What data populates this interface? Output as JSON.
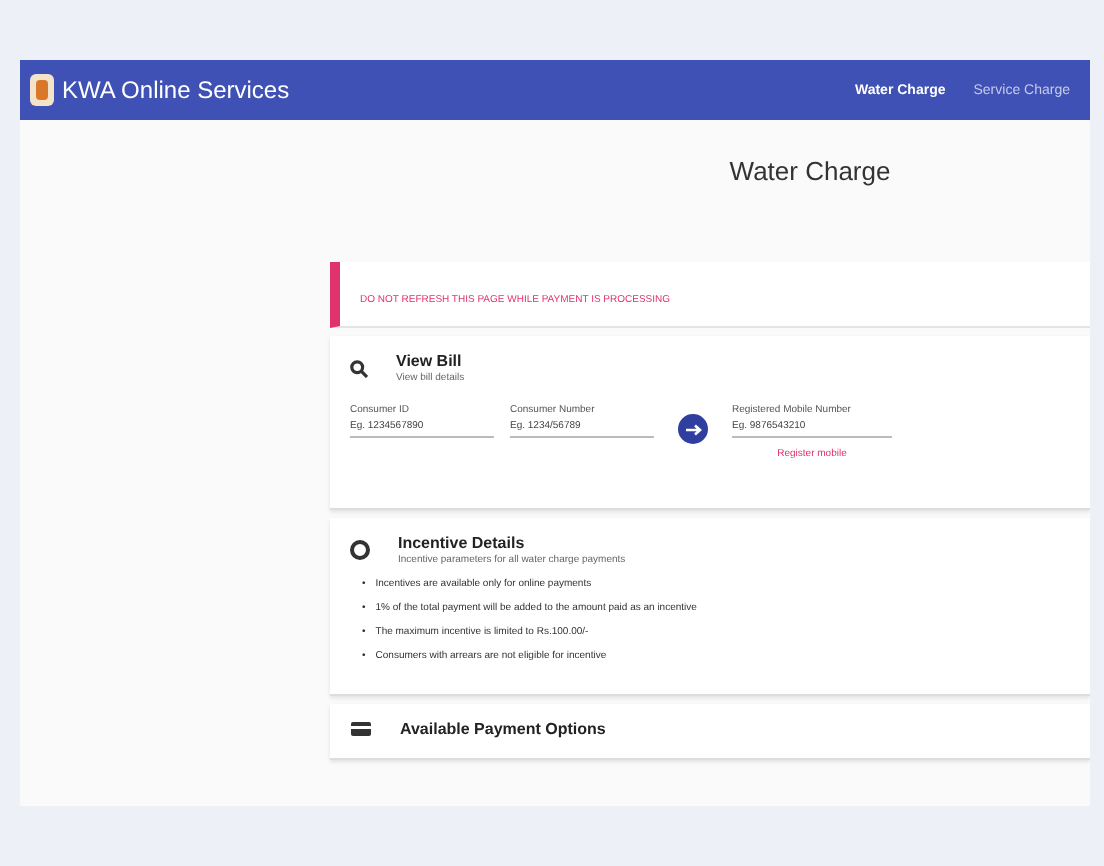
{
  "header": {
    "brand": "KWA Online Services",
    "nav": [
      {
        "label": "Water Charge",
        "selected": true
      },
      {
        "label": "Service Charge",
        "selected": false
      }
    ]
  },
  "page_title": "Water Charge",
  "alert": "DO NOT REFRESH THIS PAGE WHILE PAYMENT IS PROCESSING",
  "view_bill": {
    "title": "View Bill",
    "subtitle": "View bill details",
    "fields": [
      {
        "label": "Consumer ID",
        "placeholder": "Eg. 1234567890"
      },
      {
        "label": "Consumer Number",
        "placeholder": "Eg. 1234/56789"
      }
    ],
    "mobile": {
      "label": "Registered Mobile Number",
      "placeholder": "Eg. 9876543210"
    },
    "link": "Register mobile"
  },
  "incentive": {
    "bullet": "•",
    "title": "Incentive Details",
    "subtitle": "Incentive parameters for all water charge payments",
    "items": [
      "Incentives are available only for online payments",
      "1% of the total payment will be added to the amount paid as an incentive",
      "The maximum incentive is limited to Rs.100.00/-",
      "Consumers with arrears are not eligible for incentive"
    ]
  },
  "payment_options": {
    "title": "Available Payment Options"
  }
}
